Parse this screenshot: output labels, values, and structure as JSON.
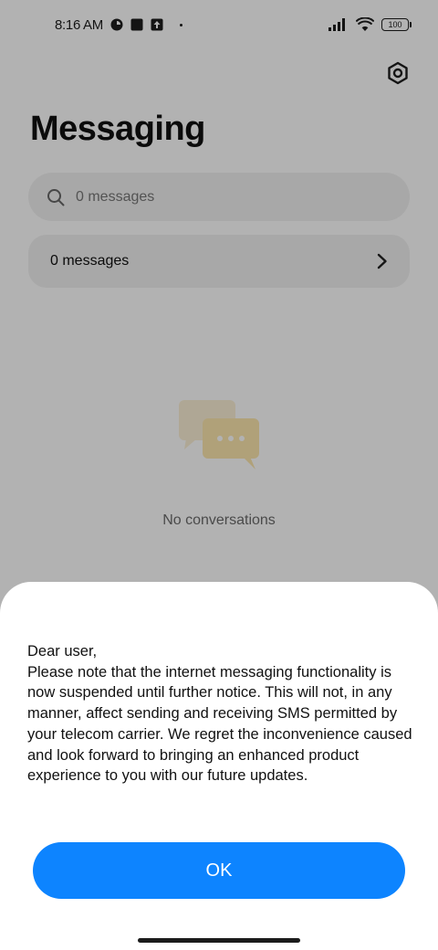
{
  "status_bar": {
    "time": "8:16 AM",
    "battery": "100",
    "icons": [
      "app-notification-icon",
      "square-notification-icon",
      "upload-notification-icon",
      "dot-indicator",
      "signal-icon",
      "wifi-icon",
      "battery-icon"
    ]
  },
  "header": {
    "title": "Messaging",
    "settings_icon": "settings-icon"
  },
  "search": {
    "placeholder": "0 messages",
    "icon": "search-icon"
  },
  "messages_row": {
    "label": "0 messages",
    "icon": "chevron-right-icon"
  },
  "empty_state": {
    "text": "No conversations",
    "icon": "chat-bubbles-icon"
  },
  "dialog": {
    "greeting": "Dear user,",
    "message": "Please note that the internet messaging functionality is now suspended until further notice. This will not, in any manner, affect sending and receiving SMS permitted by your telecom carrier. We regret the inconvenience caused and look forward to bringing an enhanced product experience to you with our future updates.",
    "ok_label": "OK"
  },
  "colors": {
    "accent": "#0d84ff",
    "scrim": "rgba(0,0,0,0.30)",
    "card_bg": "#f1f1f1"
  }
}
